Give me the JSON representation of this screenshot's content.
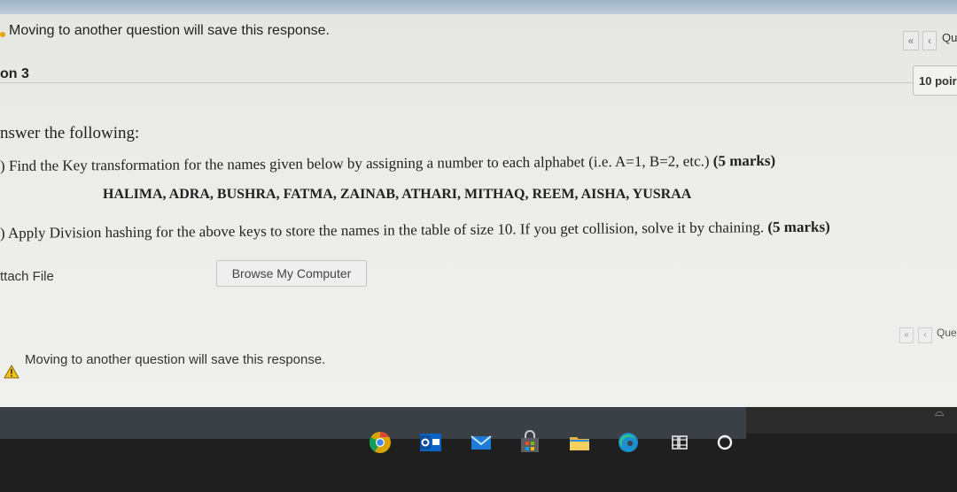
{
  "notice": {
    "top_text": "Moving to another question will save this response.",
    "bottom_text": "Moving to another question will save this response."
  },
  "nav": {
    "first_label": "«",
    "prev_label": "‹",
    "question_top": "Qu",
    "question_bottom": "Que"
  },
  "question": {
    "number_label": "on 3",
    "points": "10 poir"
  },
  "content": {
    "intro": "nswer the following:",
    "part_a_prefix": ")",
    "part_a": "Find the Key transformation for the names given below by assigning a number to each alphabet (i.e. A=1, B=2, etc.)",
    "part_a_marks": "(5 marks)",
    "names": "HALIMA, ADRA, BUSHRA, FATMA, ZAINAB, ATHARI, MITHAQ, REEM, AISHA, YUSRAA",
    "part_b_prefix": ")",
    "part_b": "Apply Division hashing for the above keys to store the names in the table of size 10. If you get collision, solve it by chaining.",
    "part_b_marks": "(5 marks)"
  },
  "attach": {
    "label": "ttach File",
    "browse_button": "Browse My Computer"
  },
  "taskbar": {
    "icons": [
      "chrome-icon",
      "outlook-icon",
      "mail-icon",
      "store-icon",
      "file-explorer-icon",
      "edge-icon",
      "task-view-icon",
      "cortana-icon"
    ]
  },
  "colors": {
    "warning": "#e8a200",
    "page_bg": "#ececea",
    "taskbar": "#3a4046"
  }
}
